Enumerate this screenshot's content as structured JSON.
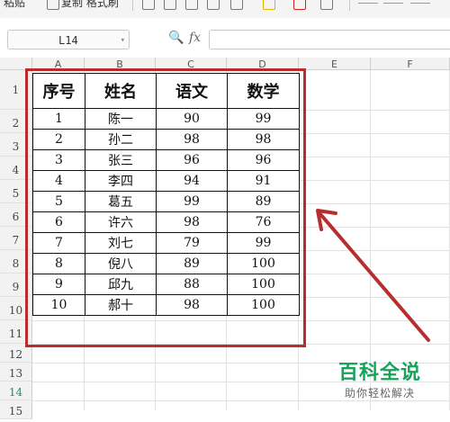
{
  "toolbar": {
    "paste_label": "粘贴",
    "format_painter_label": "复制 格式刷"
  },
  "formula_bar": {
    "cell_ref": "L14",
    "dropdown_glyph": "▾",
    "zoom_glyph": "🔍",
    "fx_label": "fx",
    "formula_value": ""
  },
  "column_headers": [
    "A",
    "B",
    "C",
    "D",
    "E",
    "F"
  ],
  "row_headers": [
    "1",
    "2",
    "3",
    "4",
    "5",
    "6",
    "7",
    "8",
    "9",
    "10",
    "11",
    "12",
    "13",
    "14",
    "15"
  ],
  "active_row": "14",
  "table": {
    "headers": [
      "序号",
      "姓名",
      "语文",
      "数学"
    ],
    "rows": [
      [
        "1",
        "陈一",
        "90",
        "99"
      ],
      [
        "2",
        "孙二",
        "98",
        "98"
      ],
      [
        "3",
        "张三",
        "96",
        "96"
      ],
      [
        "4",
        "李四",
        "94",
        "91"
      ],
      [
        "5",
        "葛五",
        "99",
        "89"
      ],
      [
        "6",
        "许六",
        "98",
        "76"
      ],
      [
        "7",
        "刘七",
        "79",
        "99"
      ],
      [
        "8",
        "倪八",
        "89",
        "100"
      ],
      [
        "9",
        "邱九",
        "88",
        "100"
      ],
      [
        "10",
        "郝十",
        "98",
        "100"
      ]
    ]
  },
  "annotation": {
    "color": "#b82e2e"
  },
  "watermark": {
    "main": "百科全说",
    "sub": "助你轻松解决",
    "color": "#17a35a"
  }
}
